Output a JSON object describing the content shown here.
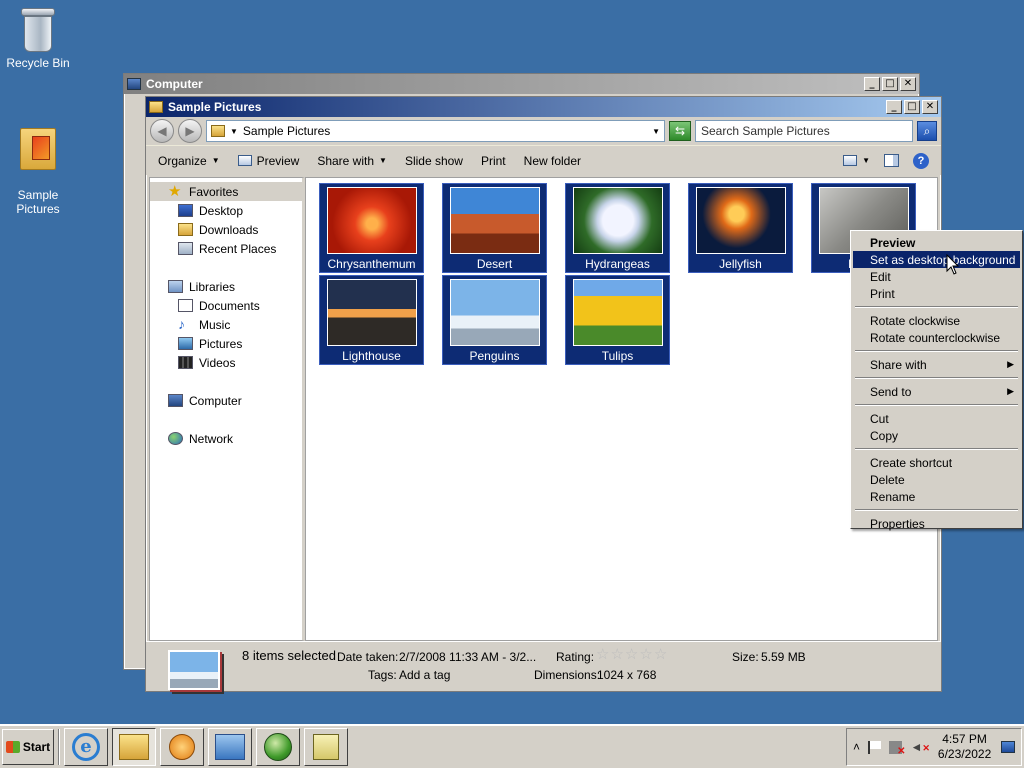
{
  "desktop": {
    "icons": [
      {
        "label": "Recycle Bin"
      },
      {
        "label": "Sample\nPictures"
      }
    ]
  },
  "back_window": {
    "title": "Computer"
  },
  "window": {
    "title": "Sample Pictures",
    "controls": {
      "minimize": "_",
      "maximize": "□",
      "close": "✕"
    },
    "address": "Sample Pictures",
    "search_placeholder": "Search Sample Pictures",
    "toolbar": [
      {
        "label": "Organize",
        "dropdown": true
      },
      {
        "label": "Preview",
        "dropdown": false
      },
      {
        "label": "Share with",
        "dropdown": true
      },
      {
        "label": "Slide show",
        "dropdown": false
      },
      {
        "label": "Print",
        "dropdown": false
      },
      {
        "label": "New folder",
        "dropdown": false
      }
    ],
    "nav": {
      "favorites": "Favorites",
      "desktop": "Desktop",
      "downloads": "Downloads",
      "recent": "Recent Places",
      "libraries": "Libraries",
      "documents": "Documents",
      "music": "Music",
      "pictures": "Pictures",
      "videos": "Videos",
      "computer": "Computer",
      "network": "Network"
    },
    "files": [
      {
        "name": "Chrysanthemum",
        "selected": true
      },
      {
        "name": "Desert",
        "selected": true
      },
      {
        "name": "Hydrangeas",
        "selected": true
      },
      {
        "name": "Jellyfish",
        "selected": true
      },
      {
        "name": "Koala",
        "selected": true
      },
      {
        "name": "Lighthouse",
        "selected": true
      },
      {
        "name": "Penguins",
        "selected": true
      },
      {
        "name": "Tulips",
        "selected": true
      }
    ],
    "details": {
      "selection": "8 items selected",
      "date_label": "Date taken:",
      "date_value": "2/7/2008 11:33 AM - 3/2...",
      "tags_label": "Tags:",
      "tags_value": "Add a tag",
      "rating_label": "Rating:",
      "rating_value": 0,
      "rating_max": 5,
      "dimensions_label": "Dimensions:",
      "dimensions_value": "1024 x 768",
      "size_label": "Size:",
      "size_value": "5.59 MB"
    }
  },
  "context_menu": {
    "preview": "Preview",
    "set_background": "Set as desktop background",
    "edit": "Edit",
    "print": "Print",
    "rotate_cw": "Rotate clockwise",
    "rotate_ccw": "Rotate counterclockwise",
    "share_with": "Share with",
    "send_to": "Send to",
    "cut": "Cut",
    "copy": "Copy",
    "create_shortcut": "Create shortcut",
    "delete": "Delete",
    "rename": "Rename",
    "properties": "Properties"
  },
  "taskbar": {
    "start": "Start",
    "time": "4:57 PM",
    "date": "6/23/2022"
  }
}
